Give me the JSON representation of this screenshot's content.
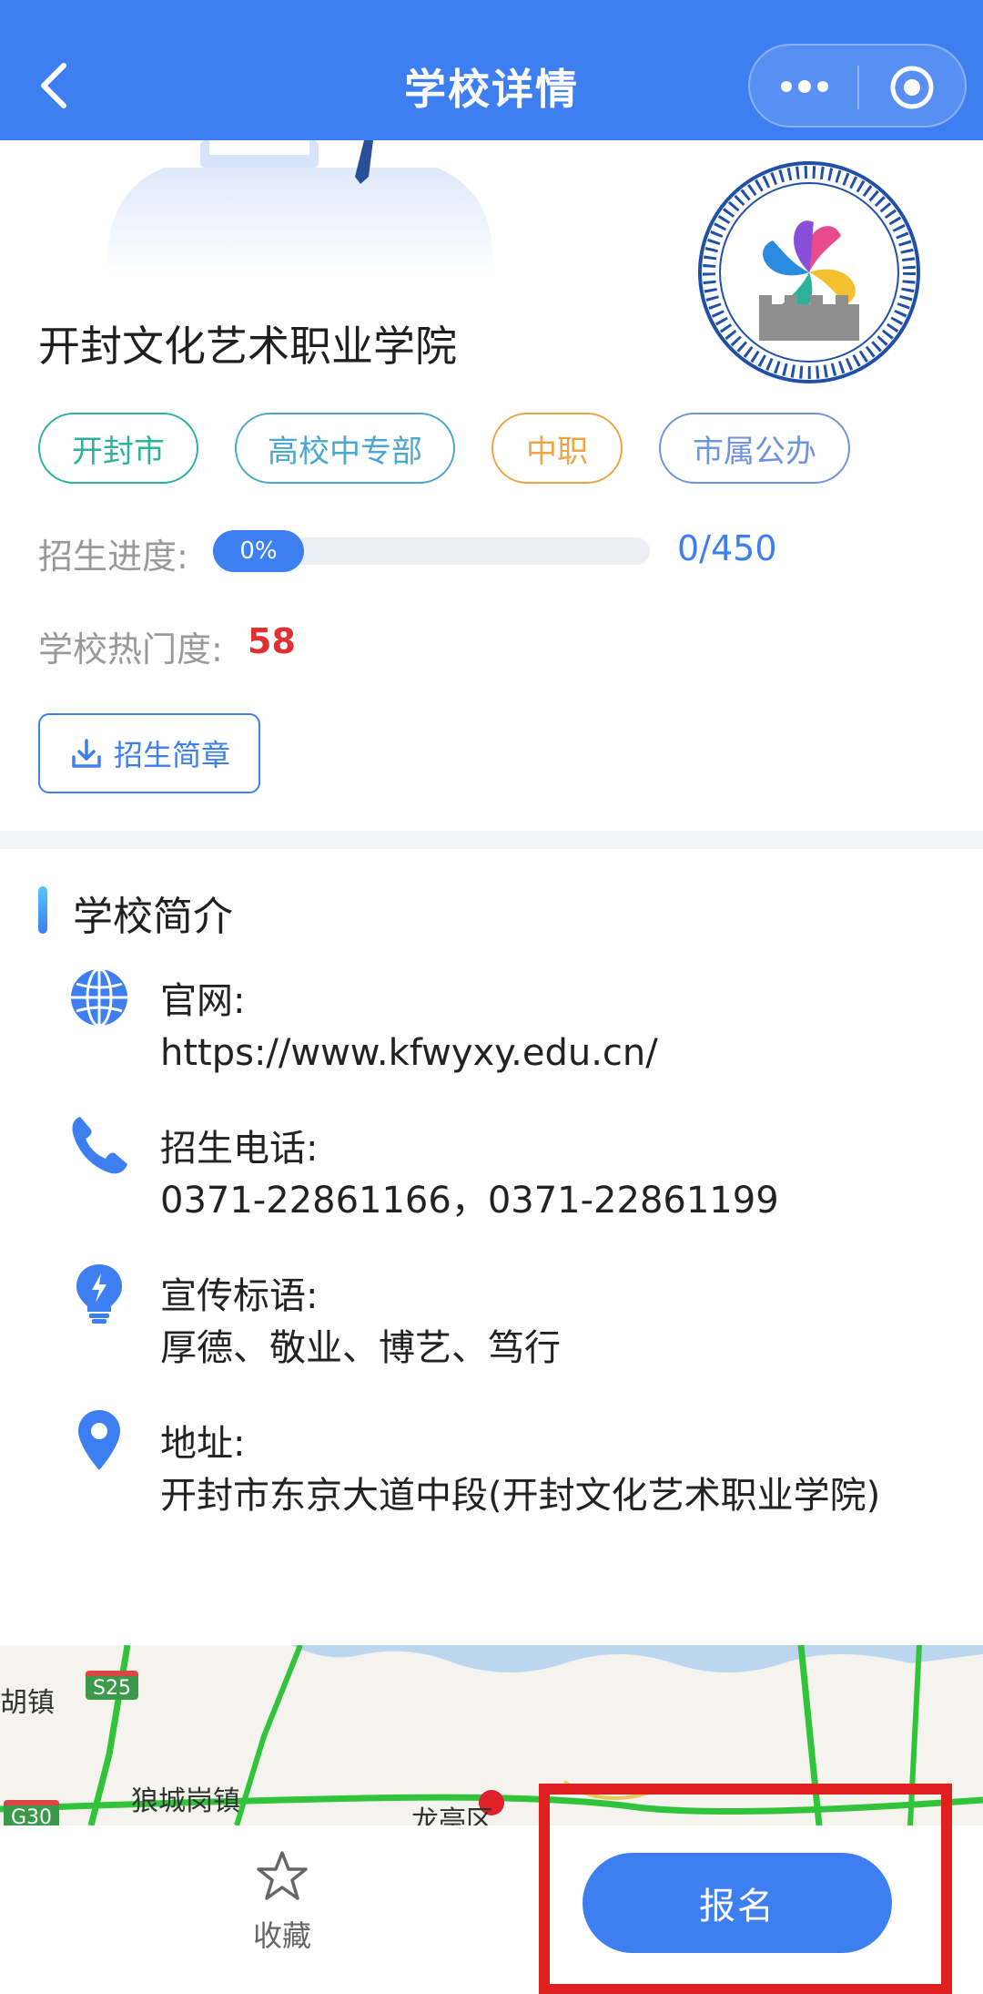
{
  "header": {
    "title": "学校详情"
  },
  "school": {
    "name": "开封文化艺术职业学院",
    "tags": [
      "开封市",
      "高校中专部",
      "中职",
      "市属公办"
    ],
    "progress_label": "招生进度:",
    "progress_value": 0,
    "progress_percent_text": "0%",
    "progress_count": "0/450",
    "hot_label": "学校热门度:",
    "hot_value": "58",
    "brochure_label": "招生简章"
  },
  "intro": {
    "title": "学校简介",
    "items": [
      {
        "icon": "globe-icon",
        "label": "官网:",
        "value": "https://www.kfwyxy.edu.cn/"
      },
      {
        "icon": "phone-icon",
        "label": "招生电话:",
        "value": "0371-22861166，0371-22861199"
      },
      {
        "icon": "lightbulb-icon",
        "label": "宣传标语:",
        "value": "厚德、敬业、博艺、笃行"
      },
      {
        "icon": "location-pin-icon",
        "label": "地址:",
        "value": "开封市东京大道中段(开封文化艺术职业学院)"
      }
    ]
  },
  "map": {
    "labels": [
      "胡镇",
      "狼城岗镇",
      "龙亭区"
    ],
    "road_badges": [
      "S25",
      "G30"
    ]
  },
  "bottom": {
    "favorite_label": "收藏",
    "signup_label": "报名"
  },
  "colors": {
    "primary": "#3d7ef0",
    "hot": "#e03030",
    "highlight": "#e01f1f"
  }
}
